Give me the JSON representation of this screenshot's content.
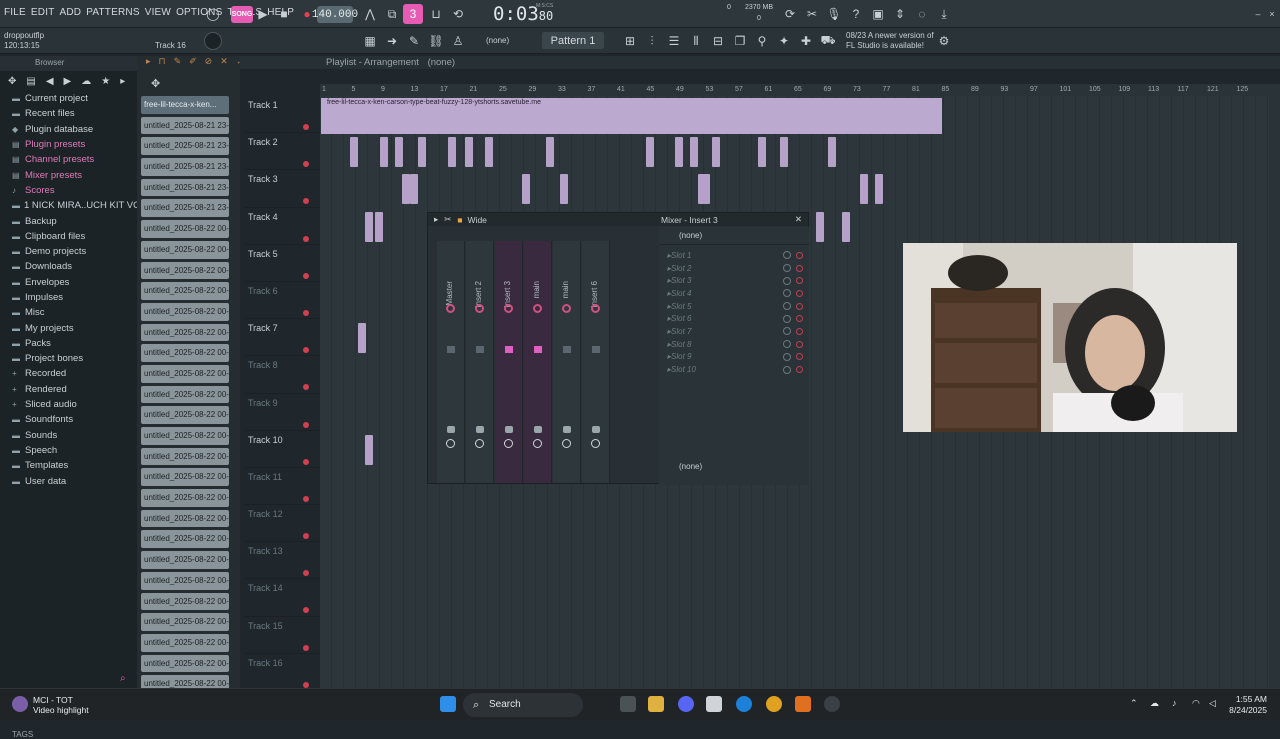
{
  "menu": [
    "FILE",
    "EDIT",
    "ADD",
    "PATTERNS",
    "VIEW",
    "OPTIONS",
    "TOOLS",
    "HELP"
  ],
  "transport": {
    "song_label": "SONG",
    "tempo": "140.000",
    "time": "0:03",
    "time_frac": "80",
    "time_sub": "M:S:CS",
    "memory": "2370 MB",
    "cpu_a": "0",
    "cpu_b": "0"
  },
  "project": {
    "file": "droppoutflp",
    "position": "120:13:15",
    "track_hint": "Track 16"
  },
  "pattern": {
    "label": "Pattern 1",
    "none_label": "(none)"
  },
  "update": {
    "date": "08/23",
    "line1": "A newer version of",
    "line2": "FL Studio is available!"
  },
  "browser": {
    "title": "Browser",
    "items": [
      {
        "label": "Current project",
        "icon": "folder",
        "pink": false
      },
      {
        "label": "Recent files",
        "icon": "folder",
        "pink": false
      },
      {
        "label": "Plugin database",
        "icon": "plugin",
        "pink": false
      },
      {
        "label": "Plugin presets",
        "icon": "preset",
        "pink": true
      },
      {
        "label": "Channel presets",
        "icon": "preset",
        "pink": true
      },
      {
        "label": "Mixer presets",
        "icon": "preset",
        "pink": true
      },
      {
        "label": "Scores",
        "icon": "note",
        "pink": true
      },
      {
        "label": "1 NICK MIRA..UCH KIT VOL 1",
        "icon": "folder",
        "pink": false
      },
      {
        "label": "Backup",
        "icon": "folder",
        "pink": false
      },
      {
        "label": "Clipboard files",
        "icon": "folder",
        "pink": false
      },
      {
        "label": "Demo projects",
        "icon": "folder",
        "pink": false
      },
      {
        "label": "Downloads",
        "icon": "folder",
        "pink": false
      },
      {
        "label": "Envelopes",
        "icon": "folder",
        "pink": false
      },
      {
        "label": "Impulses",
        "icon": "folder",
        "pink": false
      },
      {
        "label": "Misc",
        "icon": "folder",
        "pink": false
      },
      {
        "label": "My projects",
        "icon": "folder",
        "pink": false
      },
      {
        "label": "Packs",
        "icon": "folder",
        "pink": false
      },
      {
        "label": "Project bones",
        "icon": "folder",
        "pink": false
      },
      {
        "label": "Recorded",
        "icon": "plus",
        "pink": false
      },
      {
        "label": "Rendered",
        "icon": "plus",
        "pink": false
      },
      {
        "label": "Sliced audio",
        "icon": "plus",
        "pink": false
      },
      {
        "label": "Soundfonts",
        "icon": "folder",
        "pink": false
      },
      {
        "label": "Sounds",
        "icon": "folder",
        "pink": false
      },
      {
        "label": "Speech",
        "icon": "folder",
        "pink": false
      },
      {
        "label": "Templates",
        "icon": "folder",
        "pink": false
      },
      {
        "label": "User data",
        "icon": "folder",
        "pink": false
      }
    ],
    "tags_label": "TAGS"
  },
  "clips": [
    "free-lil-tecca-x-ken...",
    "untitled_2025-08-21 23-...",
    "untitled_2025-08-21 23-...",
    "untitled_2025-08-21 23-...",
    "untitled_2025-08-21 23-...",
    "untitled_2025-08-21 23-...",
    "untitled_2025-08-22 00-...",
    "untitled_2025-08-22 00-...",
    "untitled_2025-08-22 00-...",
    "untitled_2025-08-22 00-...",
    "untitled_2025-08-22 00-...",
    "untitled_2025-08-22 00-...",
    "untitled_2025-08-22 00-...",
    "untitled_2025-08-22 00-...",
    "untitled_2025-08-22 00-...",
    "untitled_2025-08-22 00-...",
    "untitled_2025-08-22 00-...",
    "untitled_2025-08-22 00-...",
    "untitled_2025-08-22 00-...",
    "untitled_2025-08-22 00-...",
    "untitled_2025-08-22 00-...",
    "untitled_2025-08-22 00-...",
    "untitled_2025-08-22 00-...",
    "untitled_2025-08-22 00-...",
    "untitled_2025-08-22 00-...",
    "untitled_2025-08-22 00-...",
    "untitled_2025-08-22 00-...",
    "untitled_2025-08-22 00-...",
    "untitled_2025-08-22 00-..."
  ],
  "playlist": {
    "title": "Playlist - Arrangement",
    "sub": "(none)",
    "ruler": [
      "1",
      "5",
      "9",
      "13",
      "17",
      "21",
      "25",
      "29",
      "33",
      "37",
      "41",
      "45",
      "49",
      "53",
      "57",
      "61",
      "65",
      "69",
      "73",
      "77",
      "81",
      "85",
      "89",
      "93",
      "97",
      "101",
      "105",
      "109",
      "113",
      "117",
      "121",
      "125"
    ],
    "tracks": [
      "Track 1",
      "Track 2",
      "Track 3",
      "Track 4",
      "Track 5",
      "Track 6",
      "Track 7",
      "Track 8",
      "Track 9",
      "Track 10",
      "Track 11",
      "Track 12",
      "Track 13",
      "Track 14",
      "Track 15",
      "Track 16"
    ],
    "dim_tracks": [
      5,
      7,
      8,
      10,
      11,
      12,
      13,
      14,
      15
    ],
    "audio_clip": "free-lil-tecca-x-ken-carson-type-beat-fuzzy-128-ytshorts.savetube.me"
  },
  "mixer": {
    "title": "Mixer - Insert 3",
    "preset": "Wide",
    "strips": [
      "Master",
      "Insert 2",
      "Insert 3",
      "main",
      "main",
      "Insert 6"
    ],
    "slot_none": "(none)",
    "slots": [
      "Slot 1",
      "Slot 2",
      "Slot 3",
      "Slot 4",
      "Slot 5",
      "Slot 6",
      "Slot 7",
      "Slot 8",
      "Slot 9",
      "Slot 10"
    ],
    "output": "(none)",
    "insert_num": "3"
  },
  "taskbar": {
    "notif_title": "MCI - TOT",
    "notif_sub": "Video highlight",
    "search": "Search",
    "time": "1:55 AM",
    "date": "8/24/2025"
  },
  "colors": {
    "accent": "#e65bb3",
    "clip": "#bca9cf",
    "bg": "#1f272c"
  }
}
